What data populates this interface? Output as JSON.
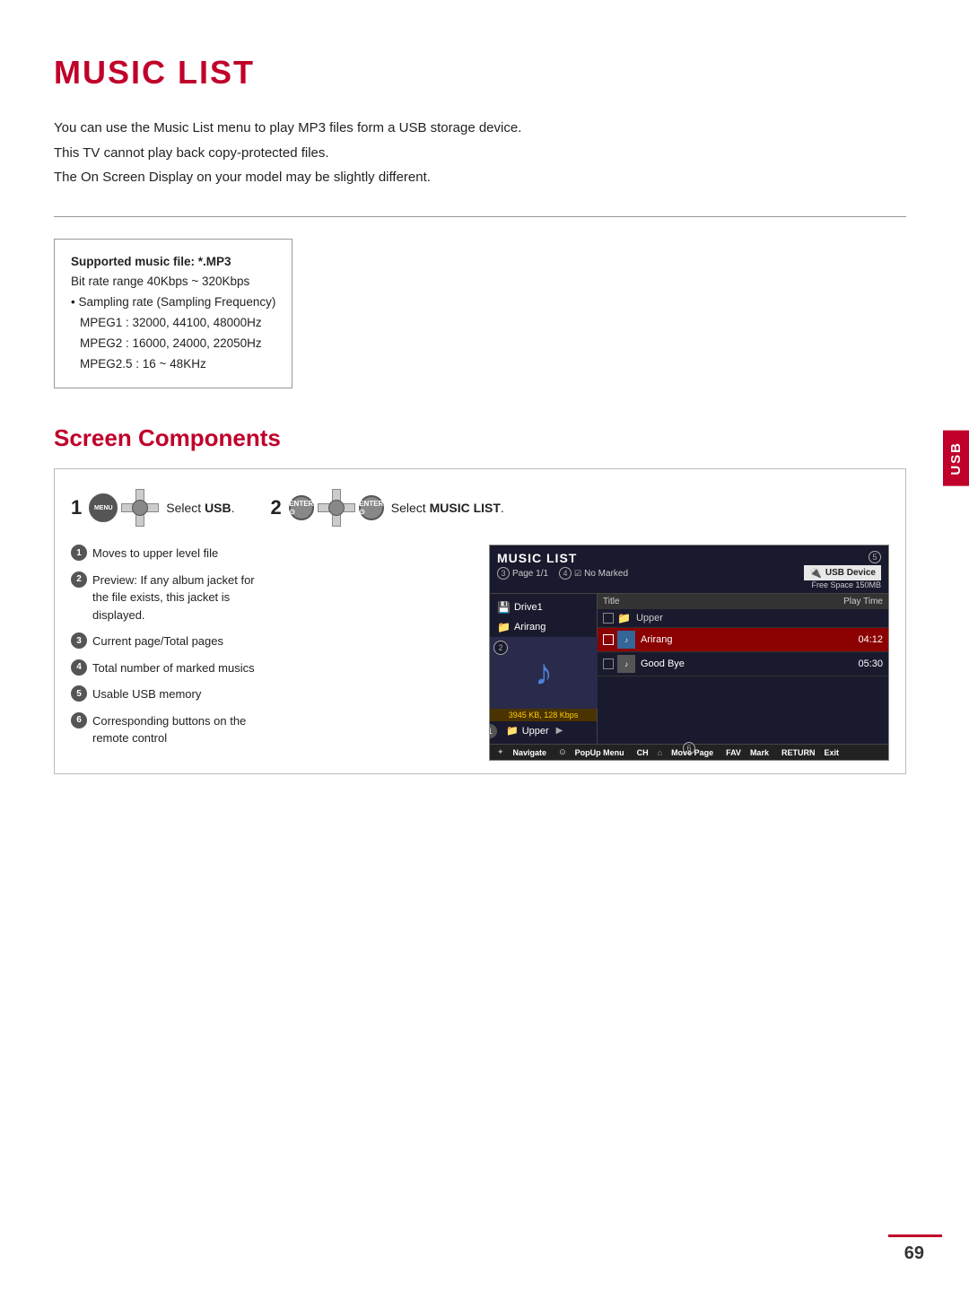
{
  "page": {
    "title": "MUSIC LIST",
    "page_number": "69"
  },
  "usb_tab": "USB",
  "description": {
    "line1": "You can use the Music List menu to play MP3 files form a USB storage device.",
    "line2": "This TV cannot play back copy-protected files.",
    "line3": "The On Screen Display on your model may be slightly different."
  },
  "info_box": {
    "label": "Supported music file: *.MP3",
    "bitrate": "Bit rate range 40Kbps ~ 320Kbps",
    "sampling": "• Sampling rate (Sampling Frequency)",
    "mpeg1": "MPEG1 : 32000, 44100, 48000Hz",
    "mpeg2": "MPEG2 : 16000, 24000, 22050Hz",
    "mpeg25": "MPEG2.5 : 16 ~ 48KHz"
  },
  "screen_components": {
    "title": "Screen Components",
    "step1": {
      "number": "1",
      "label_pre": "Select ",
      "label_bold": "USB",
      "label_post": "."
    },
    "step2": {
      "number": "2",
      "label_pre": "Select ",
      "label_bold": "MUSIC LIST",
      "label_post": "."
    },
    "bullets": [
      {
        "num": "1",
        "text": "Moves to upper level file"
      },
      {
        "num": "2",
        "text": "Preview: If any album jacket for the file exists, this jacket is displayed."
      },
      {
        "num": "3",
        "text": "Current page/Total pages"
      },
      {
        "num": "4",
        "text": "Total number of marked musics"
      },
      {
        "num": "5",
        "text": "Usable USB memory"
      },
      {
        "num": "6",
        "text": "Corresponding buttons on the remote control"
      }
    ],
    "tv_screen": {
      "title": "MUSIC LIST",
      "page_info": "Page 1/1",
      "no_marked": "No Marked",
      "usb_device": "USB Device",
      "free_space": "Free Space 150MB",
      "drive": "Drive1",
      "folder": "Arirang",
      "preview_info": "3945 KB, 128 Kbps",
      "col_title": "Title",
      "col_time": "Play Time",
      "items": [
        {
          "type": "folder",
          "name": "Upper",
          "time": ""
        },
        {
          "type": "music",
          "name": "Arirang",
          "time": "04:12",
          "selected": true
        },
        {
          "type": "music",
          "name": "Good Bye",
          "time": "05:30",
          "selected": false
        }
      ],
      "footer_items": [
        {
          "icon": "navigate",
          "label": "Navigate"
        },
        {
          "icon": "popup",
          "label": "PopUp Menu"
        },
        {
          "icon": "ch",
          "label": "CH"
        },
        {
          "icon": "move",
          "label": "Move Page"
        },
        {
          "icon": "fav",
          "label": "FAV"
        },
        {
          "icon": "mark",
          "label": "Mark"
        },
        {
          "icon": "return",
          "label": "RETURN"
        },
        {
          "icon": "exit",
          "label": "Exit"
        }
      ],
      "folder_bottom": "Upper"
    }
  }
}
